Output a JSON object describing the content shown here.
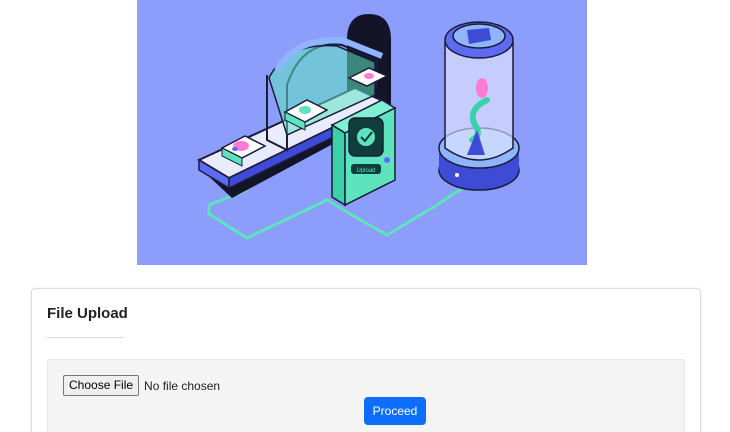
{
  "hero": {
    "illustration": "file-scanning-machine-illustration",
    "background_color": "#8c9dfc",
    "machine_label": "Upload"
  },
  "upload_card": {
    "title": "File Upload",
    "file_input": {
      "button_label": "Choose File",
      "status_text": "No file chosen"
    },
    "proceed_label": "Proceed",
    "accent_color": "#0d6efd"
  }
}
